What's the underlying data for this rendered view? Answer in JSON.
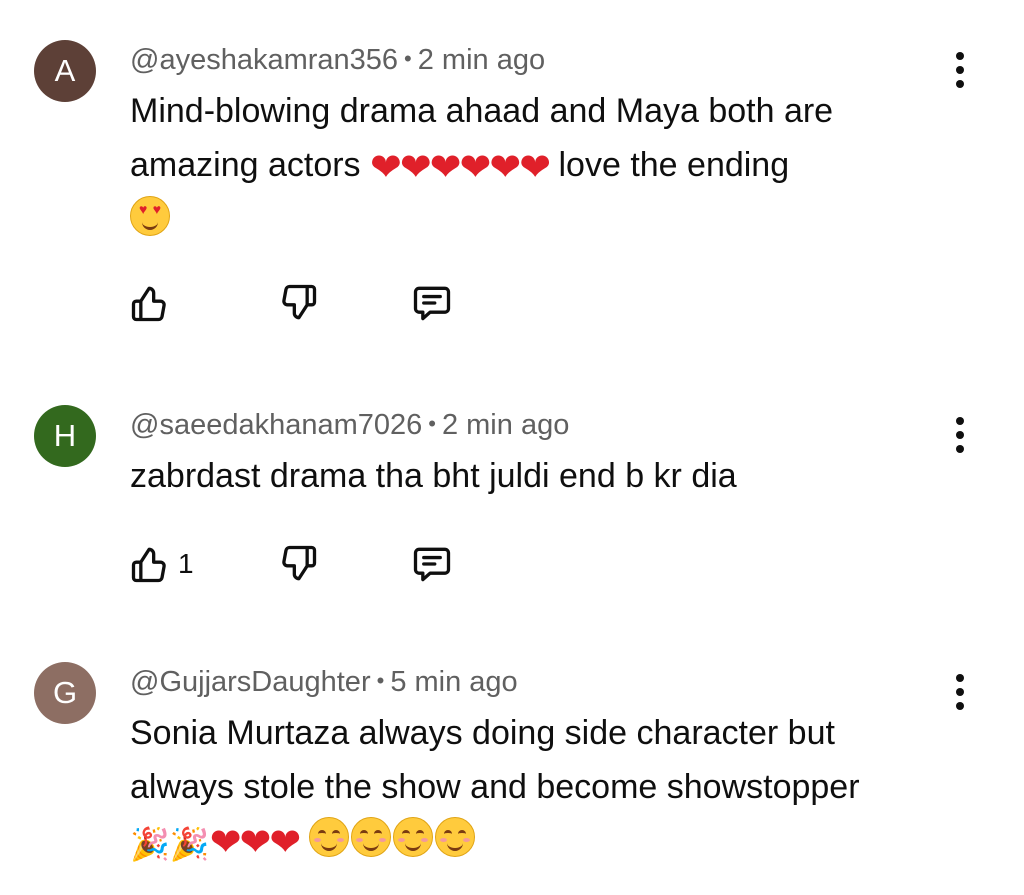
{
  "comments": [
    {
      "avatar_letter": "A",
      "avatar_color": "#5d4037",
      "handle": "@ayeshakamran356",
      "time": "2 min ago",
      "text_line1": "Mind-blowing drama ahaad and Maya both are",
      "text_line2_before": "amazing actors",
      "text_line2_after": "love the ending",
      "like_count": ""
    },
    {
      "avatar_letter": "H",
      "avatar_color": "#33691e",
      "handle": "@saeedakhanam7026",
      "time": "2 min ago",
      "text_line1": "zabrdast drama tha bht juldi end b kr dia",
      "like_count": "1"
    },
    {
      "avatar_letter": "G",
      "avatar_color": "#8d6e63",
      "handle": "@GujjarsDaughter",
      "time": "5 min ago",
      "text_line1": "Sonia Murtaza always doing side character but",
      "text_line2": "always stole the show and become showstopper",
      "like_count": ""
    }
  ],
  "separator": "•",
  "icons": {
    "like": "thumbs-up-icon",
    "dislike": "thumbs-down-icon",
    "reply": "reply-comment-icon",
    "menu": "more-vertical-icon",
    "heart": "red-heart-emoji",
    "heart_eyes": "heart-eyes-emoji",
    "party": "party-popper-emoji",
    "smile": "smiling-face-emoji"
  }
}
